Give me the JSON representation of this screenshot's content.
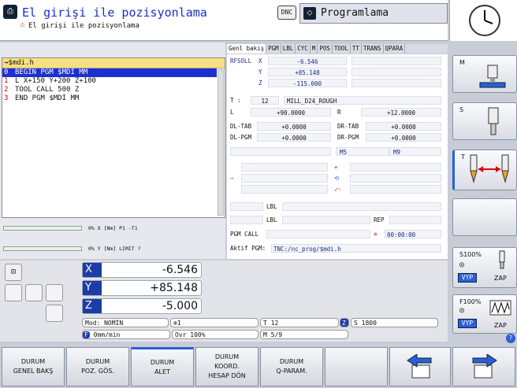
{
  "header": {
    "title": "El girişi ile pozisyonlama",
    "subtitle": "El girişi ile pozisyonlama",
    "dnc": "DNC",
    "mode": "Programlama"
  },
  "program": {
    "file": "→$mdi.h",
    "lines": [
      {
        "n": "0",
        "text": "BEGIN PGM $MDI MM"
      },
      {
        "n": "1",
        "text": "L  X+150  Y+200  Z+100"
      },
      {
        "n": "2",
        "text": "TOOL CALL 500 Z"
      },
      {
        "n": "3",
        "text": "END PGM $MDI MM"
      }
    ]
  },
  "load": {
    "x": "0% X [Nm]  P1 -T1",
    "y": "0% Y [Nm]  LIMIT ?"
  },
  "status": {
    "tabs": [
      "Genl bakış",
      "PGM",
      "LBL",
      "CYC",
      "M",
      "POS",
      "TOOL",
      "TT",
      "TRANS",
      "QPARA"
    ],
    "rfsoll": "RFSOLL",
    "ax": [
      {
        "n": "X",
        "v": "-6.546"
      },
      {
        "n": "Y",
        "v": "+85.148"
      },
      {
        "n": "Z",
        "v": "-115.000"
      }
    ],
    "t_label": "T :",
    "t_num": "12",
    "t_name": "MILL_D24_ROUGH",
    "l_label": "L",
    "l_val": "+90.0000",
    "r_label": "R",
    "r_val": "+12.0000",
    "dltab": "DL-TAB",
    "dltab_v": "+0.0000",
    "drtab": "DR-TAB",
    "drtab_v": "+0.0000",
    "dlpgm": "DL-PGM",
    "dlpgm_v": "+0.0000",
    "drpgm": "DR-PGM",
    "drpgm_v": "+0.0000",
    "m5": "M5",
    "m9": "M9",
    "lbl1": "LBL",
    "lbl2": "LBL",
    "rep": "REP",
    "pgmcall": "PGM CALL",
    "time": "00:00:00",
    "aktif_label": "Aktif PGM:",
    "aktif": "TNC:/nc_prog/$mdi.h"
  },
  "positions": [
    {
      "n": "X",
      "v": "-6.546"
    },
    {
      "n": "Y",
      "v": "+85.148"
    },
    {
      "n": "Z",
      "v": "-5.000"
    }
  ],
  "info": {
    "mod": "Mod: NOMİN",
    "p1": "1",
    "t": "T 12",
    "z": "Z",
    "s": "S 1800",
    "f": "F",
    "fval": "0mm/min",
    "ovr": "Ovr 100%",
    "m": "M 5/9"
  },
  "softkeys": [
    {
      "l1": "DURUM",
      "l2": "GENEL BAKŞ"
    },
    {
      "l1": "DURUM",
      "l2": "POZ. GÖS."
    },
    {
      "l1": "DURUM",
      "l2": "ALET"
    },
    {
      "l1": "DURUM",
      "l2": "KOORD.",
      "l3": "HESAP DÖN"
    },
    {
      "l1": "DURUM",
      "l2": "Q-PARAM."
    }
  ],
  "side": {
    "m": "M",
    "s": "S",
    "t": "T",
    "s100": "S100%",
    "f100": "F100%",
    "vyp": "VYP",
    "zap": "ZAP"
  },
  "colors": {
    "accent": "#1c3ca8",
    "highlight": "#1c30d0",
    "orange": "#f0a030"
  }
}
